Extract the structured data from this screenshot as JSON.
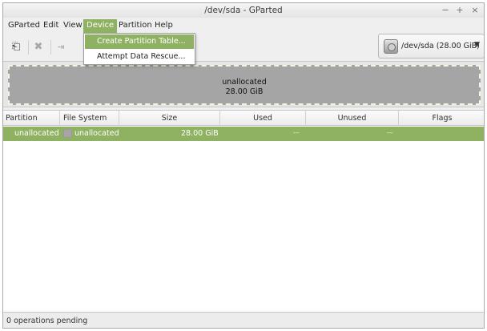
{
  "window": {
    "title": "/dev/sda - GParted",
    "controls": {
      "minimize": "−",
      "maximize": "+",
      "close": "×"
    }
  },
  "menubar": {
    "items": [
      {
        "label": "GParted"
      },
      {
        "label": "Edit"
      },
      {
        "label": "View"
      },
      {
        "label": "Device",
        "active": true
      },
      {
        "label": "Partition"
      },
      {
        "label": "Help"
      }
    ]
  },
  "device_menu": {
    "items": [
      {
        "label": "Create Partition Table...",
        "highlighted": true
      },
      {
        "label": "Attempt Data Rescue..."
      }
    ]
  },
  "toolbar": {
    "icons": [
      "new-partition-icon",
      "delete-icon",
      "resize-move-icon"
    ]
  },
  "device_selector": {
    "label": "/dev/sda   (28.00 GiB)",
    "icon": "harddisk-icon"
  },
  "disk_graphic": {
    "name": "unallocated",
    "size": "28.00 GiB"
  },
  "partition_table": {
    "columns": [
      "Partition",
      "File System",
      "Size",
      "Used",
      "Unused",
      "Flags"
    ],
    "rows": [
      {
        "partition": "unallocated",
        "file_system": "unallocated",
        "size": "28.00 GiB",
        "used": "---",
        "unused": "---",
        "flags": ""
      }
    ]
  },
  "statusbar": {
    "text": "0 operations pending"
  },
  "colors": {
    "selection": "#8fb262",
    "unallocated": "#a5a5a5"
  }
}
